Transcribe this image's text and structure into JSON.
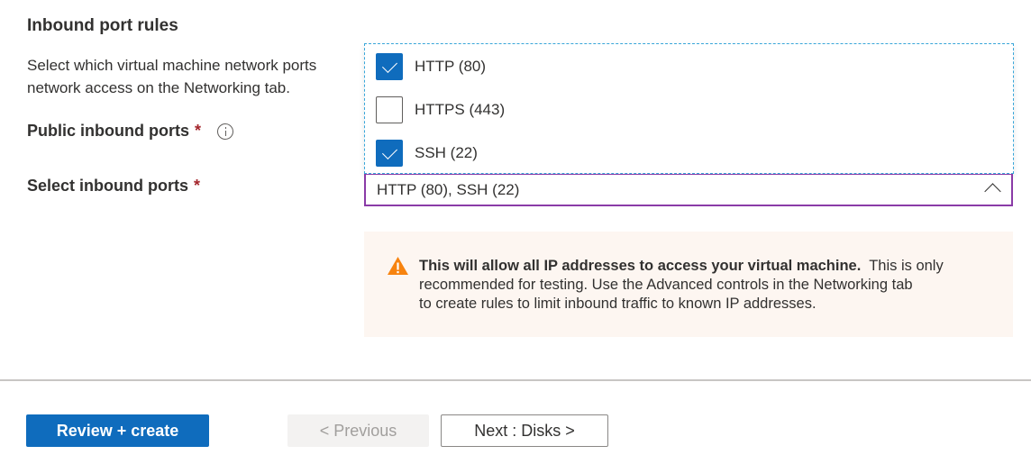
{
  "section": {
    "title": "Inbound port rules",
    "description_line1": "Select which virtual machine network ports",
    "description_line2": "network access on the Networking tab."
  },
  "fields": {
    "public_inbound_ports_label": "Public inbound ports",
    "select_inbound_ports_label": "Select inbound ports",
    "required_marker": "*"
  },
  "dropdown": {
    "selected_value": "HTTP (80), SSH (22)",
    "options": [
      {
        "label": "HTTP (80)",
        "checked": true
      },
      {
        "label": "HTTPS (443)",
        "checked": false
      },
      {
        "label": "SSH (22)",
        "checked": true
      }
    ]
  },
  "warning": {
    "bold_text": "This will allow all IP addresses to access your virtual machine.",
    "text_line1": "This is only",
    "text_line2": "recommended for testing.  Use the Advanced controls in the Networking tab",
    "text_line3": "to create rules to limit inbound traffic to known IP addresses."
  },
  "footer": {
    "review_create_label": "Review + create",
    "previous_label": "< Previous",
    "next_label": "Next : Disks >"
  },
  "colors": {
    "primary": "#0f6cbd",
    "select_border": "#8a3ba7",
    "warning_bg": "#fdf6f1",
    "warning_icon": "#f7830f",
    "required": "#a4262c"
  }
}
